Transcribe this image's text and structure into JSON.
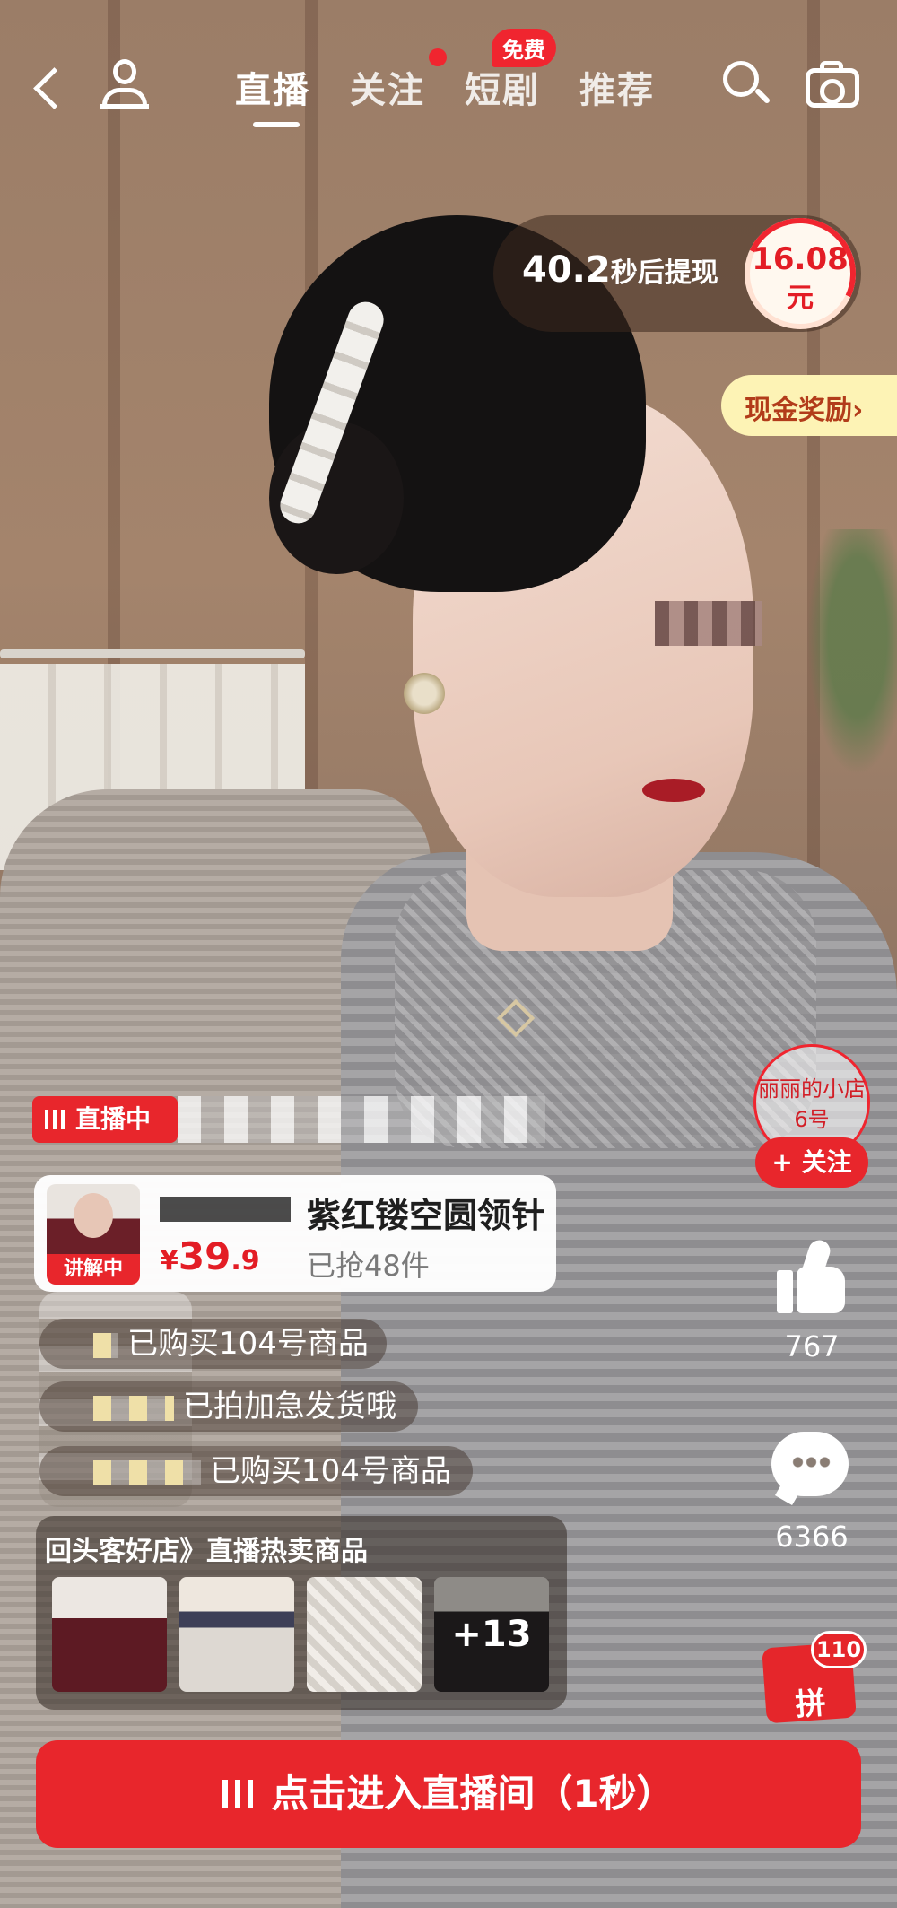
{
  "nav": {
    "tabs": [
      {
        "label": "直播",
        "active": true
      },
      {
        "label": "关注",
        "active": false
      },
      {
        "label": "短剧",
        "active": false
      },
      {
        "label": "推荐",
        "active": false
      }
    ],
    "free_badge": "免费"
  },
  "cashout": {
    "seconds": "40.2",
    "text": "秒后提现",
    "amount": "16.08",
    "unit": "元",
    "reward_label": "现金奖励"
  },
  "live": {
    "status": "直播中"
  },
  "product": {
    "explain_tag": "讲解中",
    "title": "紫红镂空圆领针",
    "currency": "¥",
    "price_int": "39",
    "price_dec": ".9",
    "sold": "已抢48件"
  },
  "shop": {
    "name": "丽丽的小店6号",
    "follow_label": "+ 关注"
  },
  "engagement": {
    "likes": "767",
    "comments": "6366",
    "pdd_label": "拼",
    "pdd_badge": "110"
  },
  "messages": [
    {
      "text": "已购买104号商品"
    },
    {
      "text": "已拍加急发货哦"
    },
    {
      "text": "已购买104号商品"
    }
  ],
  "hot_panel": {
    "header": "回头客好店》直播热卖商品",
    "more_label": "+13"
  },
  "enter_button": {
    "label": "点击进入直播间（1秒）"
  },
  "colors": {
    "accent_red": "#e8262c",
    "price_red": "#e31d25",
    "reward_bg": "#fdf3b5"
  }
}
